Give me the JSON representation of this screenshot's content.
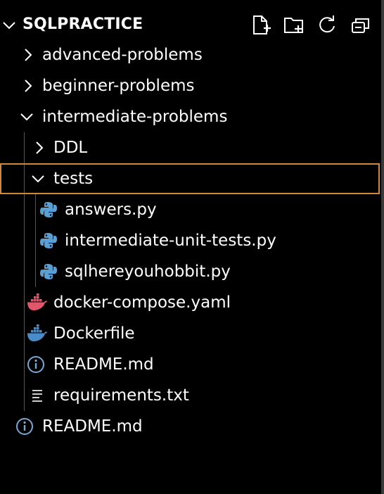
{
  "explorer": {
    "title": "SQLPRACTICE",
    "toolbar": [
      "new-file-icon",
      "new-folder-icon",
      "refresh-icon",
      "collapse-all-icon"
    ],
    "items": [
      {
        "label": "advanced-problems",
        "type": "folder",
        "expanded": false
      },
      {
        "label": "beginner-problems",
        "type": "folder",
        "expanded": false
      },
      {
        "label": "intermediate-problems",
        "type": "folder",
        "expanded": true
      },
      {
        "label": "DDL",
        "type": "folder",
        "expanded": false
      },
      {
        "label": "tests",
        "type": "folder",
        "expanded": true,
        "selected": true
      },
      {
        "label": "answers.py",
        "type": "file",
        "icon": "python-icon"
      },
      {
        "label": "intermediate-unit-tests.py",
        "type": "file",
        "icon": "python-icon"
      },
      {
        "label": "sqlhereyouhobbit.py",
        "type": "file",
        "icon": "python-icon"
      },
      {
        "label": "docker-compose.yaml",
        "type": "file",
        "icon": "docker-icon"
      },
      {
        "label": "Dockerfile",
        "type": "file",
        "icon": "docker-icon"
      },
      {
        "label": "README.md",
        "type": "file",
        "icon": "info-icon"
      },
      {
        "label": "requirements.txt",
        "type": "file",
        "icon": "lines-icon"
      },
      {
        "label": "README.md",
        "type": "file",
        "icon": "info-icon"
      }
    ]
  },
  "colors": {
    "background": "#000000",
    "text": "#ffffff",
    "selection_border": "#d3853a",
    "python_icon": "#5a9fd4",
    "docker_compose_icon": "#e0566b",
    "docker_icon": "#4a8cc7",
    "info_icon": "#7aa8d6",
    "icon_gray": "#cccccc"
  }
}
